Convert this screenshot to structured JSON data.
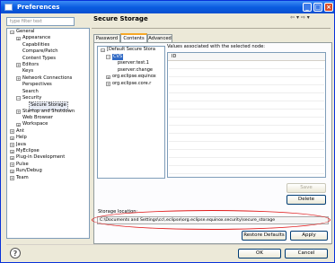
{
  "window": {
    "title": "Preferences"
  },
  "filter": {
    "placeholder": "type filter text"
  },
  "tree": [
    {
      "label": "General",
      "level": 0,
      "toggle": "−"
    },
    {
      "label": "Appearance",
      "level": 1,
      "toggle": "+"
    },
    {
      "label": "Capabilities",
      "level": 1,
      "toggle": ""
    },
    {
      "label": "Compare/Patch",
      "level": 1,
      "toggle": ""
    },
    {
      "label": "Content Types",
      "level": 1,
      "toggle": ""
    },
    {
      "label": "Editors",
      "level": 1,
      "toggle": "+"
    },
    {
      "label": "Keys",
      "level": 1,
      "toggle": ""
    },
    {
      "label": "Network Connections",
      "level": 1,
      "toggle": "+"
    },
    {
      "label": "Perspectives",
      "level": 1,
      "toggle": ""
    },
    {
      "label": "Search",
      "level": 1,
      "toggle": ""
    },
    {
      "label": "Security",
      "level": 1,
      "toggle": "−"
    },
    {
      "label": "Secure Storage",
      "level": 2,
      "toggle": "",
      "selected": true
    },
    {
      "label": "Startup and Shutdown",
      "level": 1,
      "toggle": "+"
    },
    {
      "label": "Web Browser",
      "level": 1,
      "toggle": ""
    },
    {
      "label": "Workspace",
      "level": 1,
      "toggle": "+"
    },
    {
      "label": "Ant",
      "level": 0,
      "toggle": "+"
    },
    {
      "label": "Help",
      "level": 0,
      "toggle": "+"
    },
    {
      "label": "Java",
      "level": 0,
      "toggle": "+"
    },
    {
      "label": "MyEclipse",
      "level": 0,
      "toggle": "+"
    },
    {
      "label": "Plug-in Development",
      "level": 0,
      "toggle": "+"
    },
    {
      "label": "Pulse",
      "level": 0,
      "toggle": "+"
    },
    {
      "label": "Run/Debug",
      "level": 0,
      "toggle": "+"
    },
    {
      "label": "Team",
      "level": 0,
      "toggle": "+"
    }
  ],
  "page": {
    "title": "Secure Storage",
    "tabs": [
      "Password",
      "Contents",
      "Advanced"
    ],
    "active_tab": "Contents"
  },
  "storage_tree": [
    {
      "label": "[Default Secure Stora",
      "level": 0,
      "toggle": "−"
    },
    {
      "label": "CVS",
      "level": 1,
      "toggle": "−",
      "highlight": true
    },
    {
      "label": "pserver:test.1",
      "level": 2,
      "toggle": ""
    },
    {
      "label": "pserver:change",
      "level": 2,
      "toggle": ""
    },
    {
      "label": "org.eclipse.equinox",
      "level": 1,
      "toggle": "+"
    },
    {
      "label": "org.eclipse.core.r",
      "level": 1,
      "toggle": "+"
    }
  ],
  "values": {
    "label": "Values associated with the selected node:",
    "column": "ID"
  },
  "buttons": {
    "save": "Save",
    "delete": "Delete",
    "restore_defaults": "Restore Defaults",
    "apply": "Apply",
    "ok": "OK",
    "cancel": "Cancel"
  },
  "storage_location": {
    "label": "Storage location:",
    "path": "C:\\Documents and Settings\\cc\\.eclipse\\org.eclipse.equinox.security\\secure_storage"
  },
  "colors": {
    "accent": "#0a5ce0",
    "annotation": "#e01818",
    "highlight": "#316ac5"
  }
}
